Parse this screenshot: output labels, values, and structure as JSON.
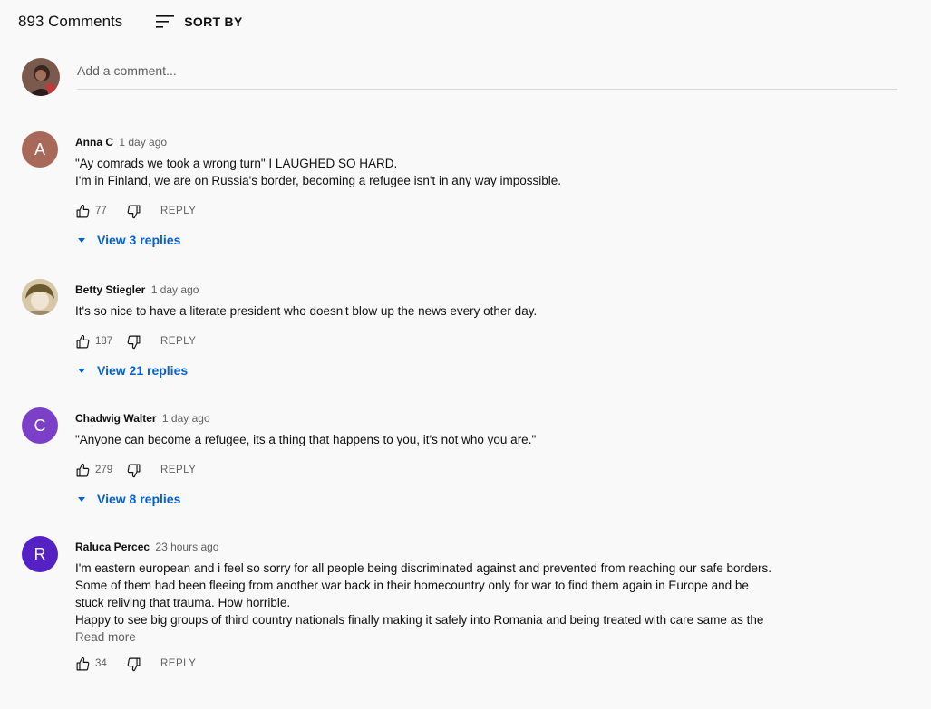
{
  "header": {
    "count": "893 Comments",
    "sort_label": "SORT BY"
  },
  "add_comment": {
    "placeholder": "Add a comment..."
  },
  "comments": [
    {
      "author": "Anna C",
      "time": "1 day ago",
      "avatar_letter": "A",
      "avatar_color": "#a8695a",
      "lines": [
        "\"Ay comrads we took a wrong turn\"   I LAUGHED SO HARD.",
        "I'm in Finland, we are on Russia's border, becoming a refugee isn't in any way impossible."
      ],
      "likes": "77",
      "reply_label": "REPLY",
      "replies_label": "View 3 replies"
    },
    {
      "author": "Betty Stiegler",
      "time": "1 day ago",
      "lines": [
        "It's so nice to have a literate president who doesn't blow up the news every other day."
      ],
      "likes": "187",
      "reply_label": "REPLY",
      "replies_label": "View 21 replies"
    },
    {
      "author": "Chadwig Walter",
      "time": "1 day ago",
      "avatar_letter": "C",
      "avatar_color": "#7b3fc8",
      "lines": [
        "\"Anyone can become a refugee, its a thing that happens to you, it's not who you are.\""
      ],
      "likes": "279",
      "reply_label": "REPLY",
      "replies_label": "View 8 replies"
    },
    {
      "author": "Raluca Percec",
      "time": "23 hours ago",
      "avatar_letter": "R",
      "avatar_color": "#5321c4",
      "lines": [
        "I'm eastern european and i feel so sorry for all people being discriminated against and prevented from reaching our safe borders.",
        "Some of them had been fleeing from another war back in their homecountry only for war to find them again in Europe and be",
        "stuck reliving that trauma. How horrible.",
        "Happy to see big groups of third country nationals finally making it safely into Romania and being treated with care same as the"
      ],
      "read_more": "Read more",
      "likes": "34",
      "reply_label": "REPLY"
    }
  ],
  "colors": {
    "link_blue": "#065fd4",
    "secondary_text": "#606060",
    "background": "#f9f9f9"
  }
}
